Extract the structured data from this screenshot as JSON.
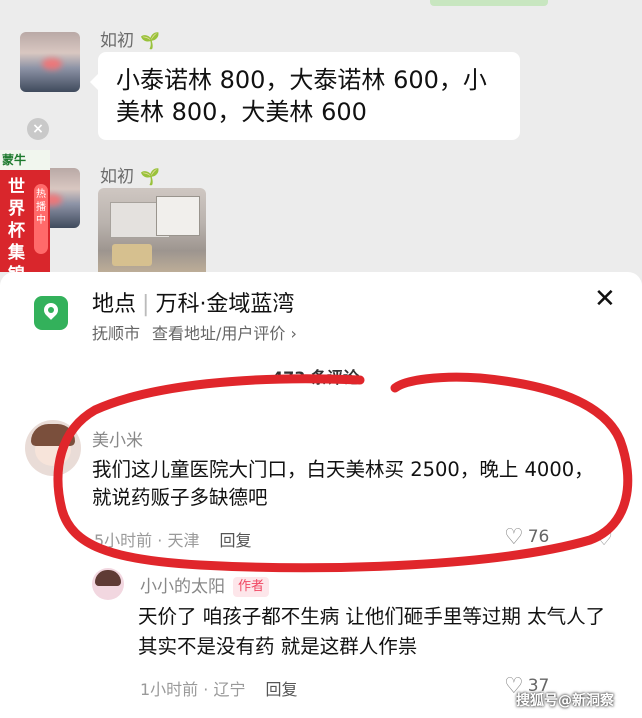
{
  "chat": {
    "message1": {
      "sender": "如初",
      "sprout": "🌱",
      "text": "小泰诺林 800，大泰诺林 600，小美林 800，大美林 600"
    },
    "message2": {
      "sender": "如初",
      "sprout": "🌱"
    },
    "close_glyph": "×"
  },
  "ad": {
    "brand": "蒙牛",
    "title": "世界杯集锦",
    "tag": "热播中"
  },
  "location": {
    "label": "地点",
    "separator": "|",
    "name": "万科·金域蓝湾",
    "city": "抚顺市",
    "link": "查看地址/用户评价 ›",
    "close": "✕"
  },
  "comments": {
    "count_label": "473 条评论",
    "items": [
      {
        "user": "美小米",
        "text": "我们这儿童医院大门口，白天美林买 2500，晚上 4000，就说药贩子多缺德吧",
        "time_place": "5小时前 · 天津",
        "reply": "回复",
        "likes": "76"
      },
      {
        "user": "小小的太阳",
        "badge": "作者",
        "text": "天价了 咱孩子都不生病 让他们砸手里等过期 太气人了 其实不是没有药 就是这群人作祟",
        "time_place": "1小时前 · 辽宁",
        "reply": "回复",
        "likes": "37"
      }
    ]
  },
  "watermark": "搜狐号@新洞察",
  "colors": {
    "annotation_circle": "#e0262b",
    "location_icon": "#33b15b",
    "author_badge": "#f04863"
  }
}
